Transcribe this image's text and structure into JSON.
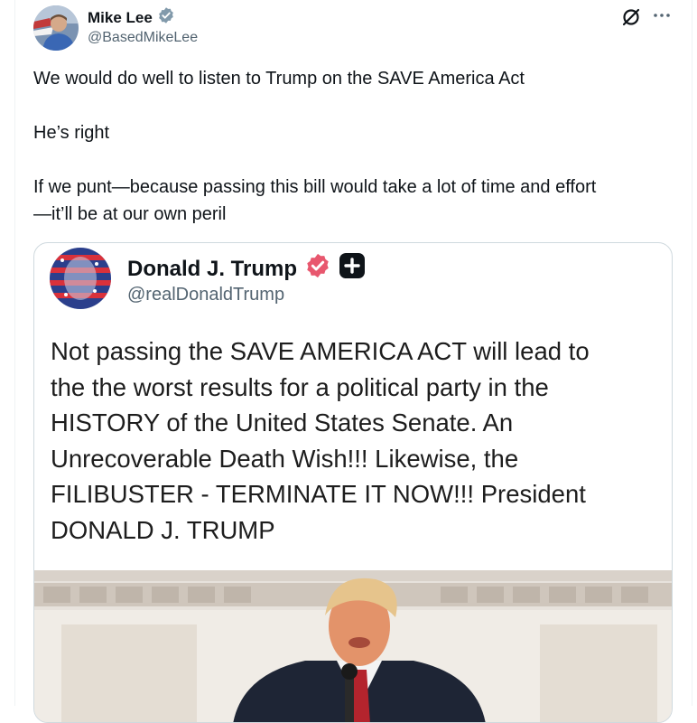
{
  "post": {
    "author_name": "Mike Lee",
    "author_handle": "@BasedMikeLee",
    "verified": true,
    "lines": [
      "We would do well to listen to Trump on the SAVE America Act",
      "He’s right",
      "If we punt—because passing this bill would take a lot of time and effort",
      "—it’ll be at our own peril"
    ]
  },
  "quote": {
    "author_name": "Donald J. Trump",
    "author_handle": "@realDonaldTrump",
    "text_lines": [
      "Not passing the SAVE AMERICA ACT will lead to",
      "the the worst results for a political party in the",
      "HISTORY of the United States Senate. An",
      "Unrecoverable Death Wish!!! Likewise, the",
      "FILIBUSTER - TERMINATE IT NOW!!! President",
      "DONALD J. TRUMP"
    ]
  },
  "icons": {
    "verified": "verified-badge-icon",
    "grok": "grok-icon",
    "more": "more-icon",
    "truth_verified": "truth-verified-badge-icon",
    "truth_plus": "truth-plus-icon"
  },
  "colors": {
    "verified_gray": "#829aab",
    "truth_badge": "#e8576e",
    "handle": "#536471",
    "border": "#cfd9de"
  }
}
